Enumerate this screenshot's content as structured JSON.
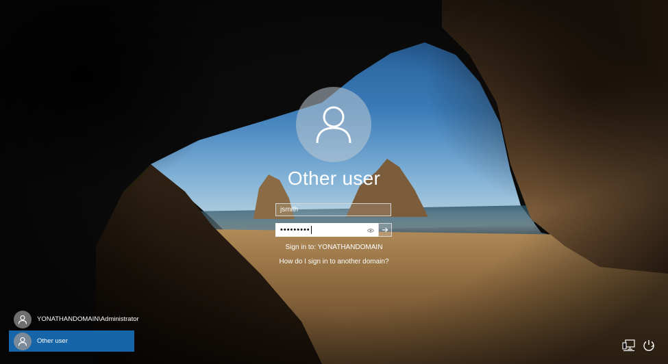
{
  "login": {
    "user_name": "Other user",
    "username_value": "jsmith",
    "password_mask": "•••••••••",
    "sign_in_to": "Sign in to: YONATHANDOMAIN",
    "domain_help_link": "How do I sign in to another domain?"
  },
  "users": [
    {
      "label": "YONATHANDOMAIN\\Administrator",
      "selected": false
    },
    {
      "label": "Other user",
      "selected": true
    }
  ],
  "icons": {
    "avatar": "person-icon",
    "reveal": "eye-icon",
    "submit": "arrow-right-icon",
    "network": "network-icon",
    "power": "power-icon"
  },
  "colors": {
    "selected_tile": "#1565a8"
  }
}
